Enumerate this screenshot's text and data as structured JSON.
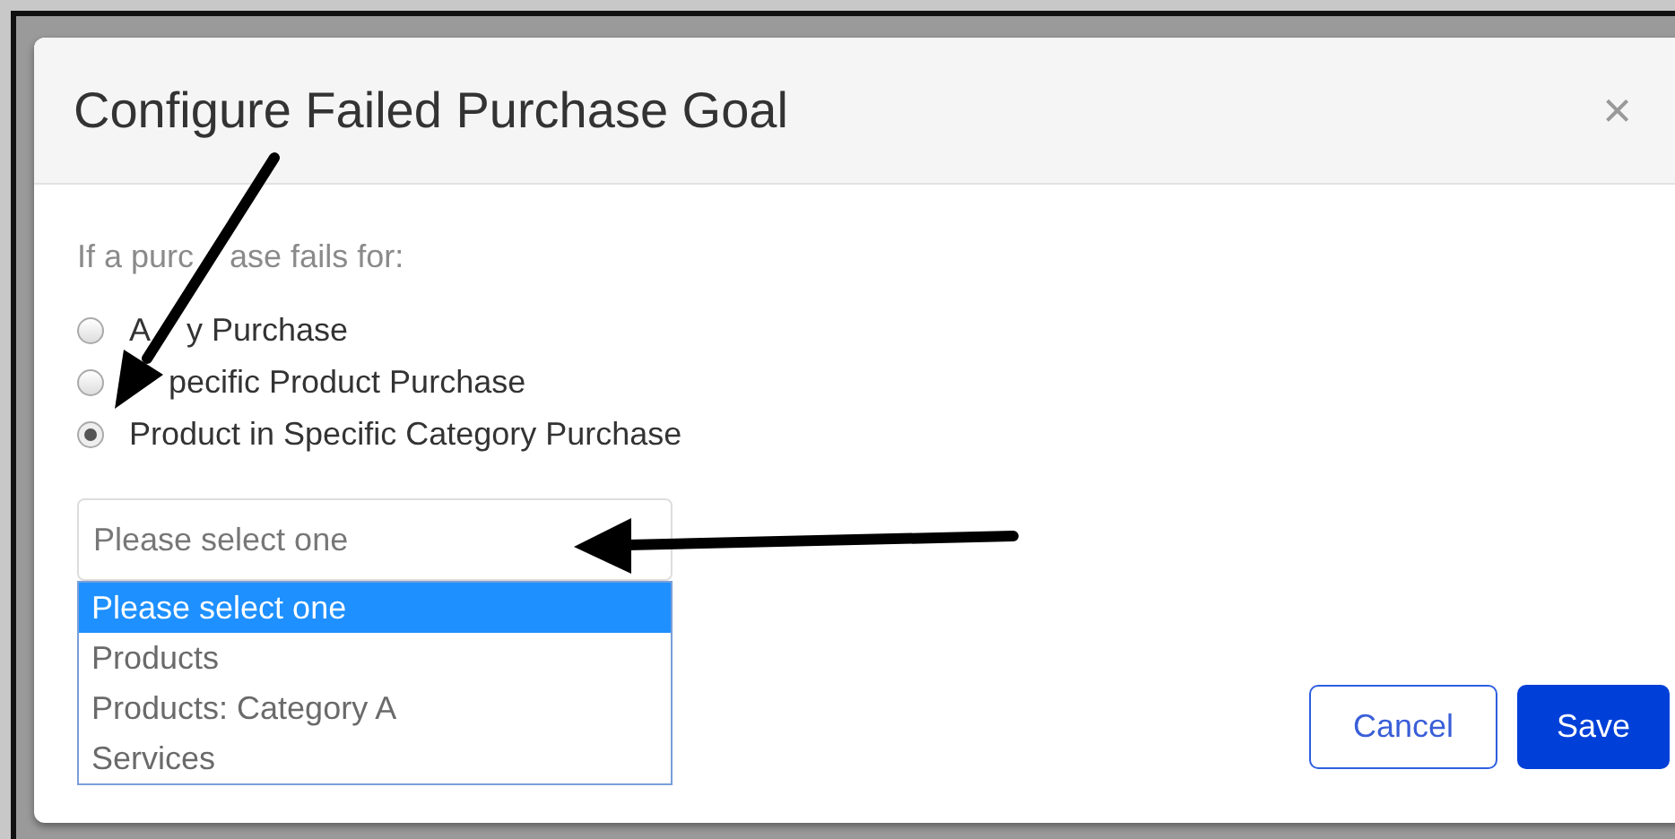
{
  "dialog": {
    "title": "Configure Failed Purchase Goal",
    "close": "×"
  },
  "prompt": [
    "If a purc",
    "ase fails for:"
  ],
  "options": [
    {
      "label": [
        "A",
        "y Purchase"
      ],
      "selected": false
    },
    {
      "label": [
        "pecific Product Purchase"
      ],
      "covered_start": true,
      "selected": false
    },
    {
      "label": [
        "Product in Specific Category Purchase"
      ],
      "selected": true
    }
  ],
  "select": {
    "value": "Please select one",
    "expanded": true,
    "items": [
      {
        "label": "Please select one",
        "selected": true
      },
      {
        "label": "Products",
        "selected": false
      },
      {
        "label": "Products: Category A",
        "selected": false
      },
      {
        "label": "Services",
        "selected": false
      }
    ]
  },
  "buttons": [
    {
      "label": "Cancel",
      "kind": "secondary"
    },
    {
      "label": "Save",
      "kind": "primary"
    }
  ]
}
